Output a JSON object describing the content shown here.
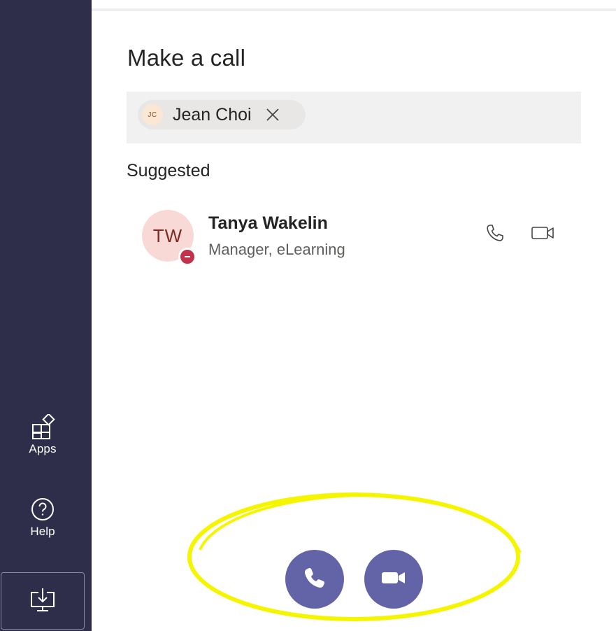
{
  "rail": {
    "apps_label": "Apps",
    "help_label": "Help",
    "apps_icon": "apps-icon",
    "help_icon": "help-icon",
    "download_icon": "download-icon"
  },
  "call_panel": {
    "title": "Make a call",
    "recipient": {
      "initials": "JC",
      "name": "Jean Choi",
      "remove_icon": "close-icon"
    },
    "suggested_heading": "Suggested",
    "suggested": [
      {
        "initials": "TW",
        "name": "Tanya Wakelin",
        "role": "Manager, eLearning",
        "presence": "do-not-disturb",
        "presence_color": "#c4314b"
      }
    ],
    "audio_call_icon": "phone-icon",
    "video_call_icon": "video-camera-icon"
  },
  "colors": {
    "rail_background": "#2f2e4a",
    "accent": "#6264a7",
    "annotation": "#f5f500"
  }
}
